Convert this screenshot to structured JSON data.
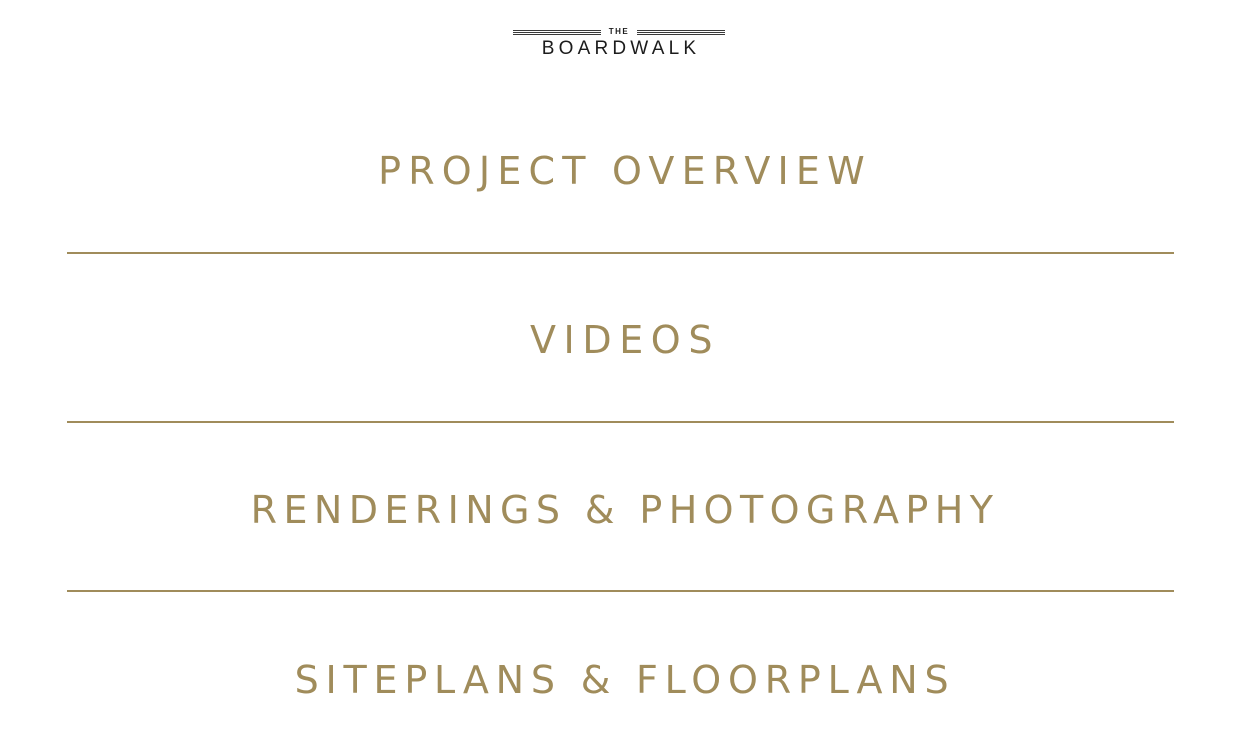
{
  "logo": {
    "top_text": "THE",
    "main_text": "BOARDWALK"
  },
  "menu": {
    "items": [
      {
        "label": "PROJECT OVERVIEW"
      },
      {
        "label": "VIDEOS"
      },
      {
        "label": "RENDERINGS & PHOTOGRAPHY"
      },
      {
        "label": "SITEPLANS & FLOORPLANS"
      }
    ]
  },
  "colors": {
    "accent_gold": "#a08c5b",
    "logo_dark": "#1c1c1c",
    "background": "#ffffff"
  }
}
